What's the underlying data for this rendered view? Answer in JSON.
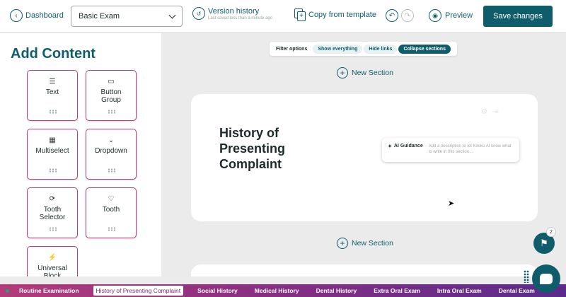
{
  "header": {
    "back_label": "Dashboard",
    "exam_select": "Basic Exam",
    "version_history_label": "Version history",
    "version_history_sub": "Last saved less than a minute ago",
    "copy_label": "Copy from template",
    "preview_label": "Preview",
    "save_label": "Save changes"
  },
  "sidebar": {
    "title": "Add Content",
    "tiles": [
      {
        "label": "Text",
        "icon": "text-lines-icon"
      },
      {
        "label": "Button Group",
        "icon": "button-group-icon"
      },
      {
        "label": "Multiselect",
        "icon": "grid-icon"
      },
      {
        "label": "Dropdown",
        "icon": "chevron-down-icon"
      },
      {
        "label": "Tooth Selector",
        "icon": "cycle-icon"
      },
      {
        "label": "Tooth",
        "icon": "tooth-icon"
      },
      {
        "label": "Universal Block",
        "icon": "bolt-icon"
      }
    ]
  },
  "filter": {
    "label": "Filter options",
    "options": [
      "Show everything",
      "Hide links",
      "Collapse sections"
    ],
    "active": "Collapse sections"
  },
  "canvas": {
    "new_section_label": "New Section",
    "card_title": "History of Presenting Complaint",
    "guidance_label": "AI Guidance",
    "guidance_desc": "Add a description to let Kiroku AI know what to write in this section..."
  },
  "flag_badge": "2",
  "bottom_nav": {
    "items": [
      "Routine Examination",
      "History of Presenting Complaint",
      "Social History",
      "Medical History",
      "Dental History",
      "Extra Oral Exam",
      "Intra Oral Exam",
      "Dental Exam"
    ],
    "active": "History of Presenting Complaint"
  },
  "colors": {
    "accent": "#0f5d6b",
    "tile_border": "#b43c7a"
  }
}
